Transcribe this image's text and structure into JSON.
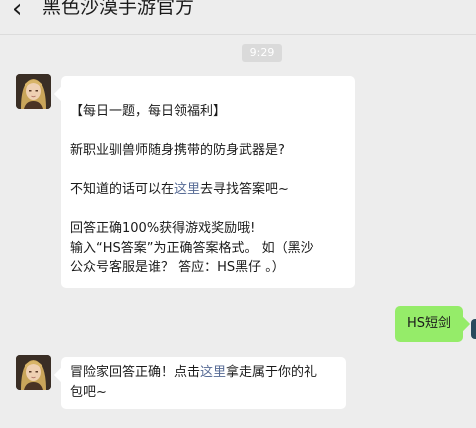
{
  "header": {
    "back_icon": "‹",
    "title": "黑色沙漠手游官方"
  },
  "chat": {
    "timestamp": "9:29",
    "message1": {
      "line1": "【每日一题，每日领福利】",
      "line2": "新职业驯兽师随身携带的防身武器是?",
      "line3_pre": "不知道的话可以在",
      "line3_link": "这里",
      "line3_post": "去寻找答案吧~",
      "line4": "回答正确100%获得游戏奖励哦!",
      "line5": "输入“HS答案”为正确答案格式。 如（黑沙",
      "line6": "公众号客服是谁？ 答应：HS黑仔 。）"
    },
    "reply": {
      "text": "HS短剑"
    },
    "message2": {
      "line1_pre": "冒险家回答正确！点击",
      "line1_link": "这里",
      "line1_post": "拿走属于你的礼",
      "line2": "包吧~"
    }
  },
  "colors": {
    "background": "#ededed",
    "bubble_left": "#ffffff",
    "bubble_right": "#95ec69",
    "link": "#576b95",
    "timestamp_bg": "#dadada"
  },
  "icons": {
    "back": "chevron-left-icon",
    "avatar": "game-character-avatar"
  }
}
